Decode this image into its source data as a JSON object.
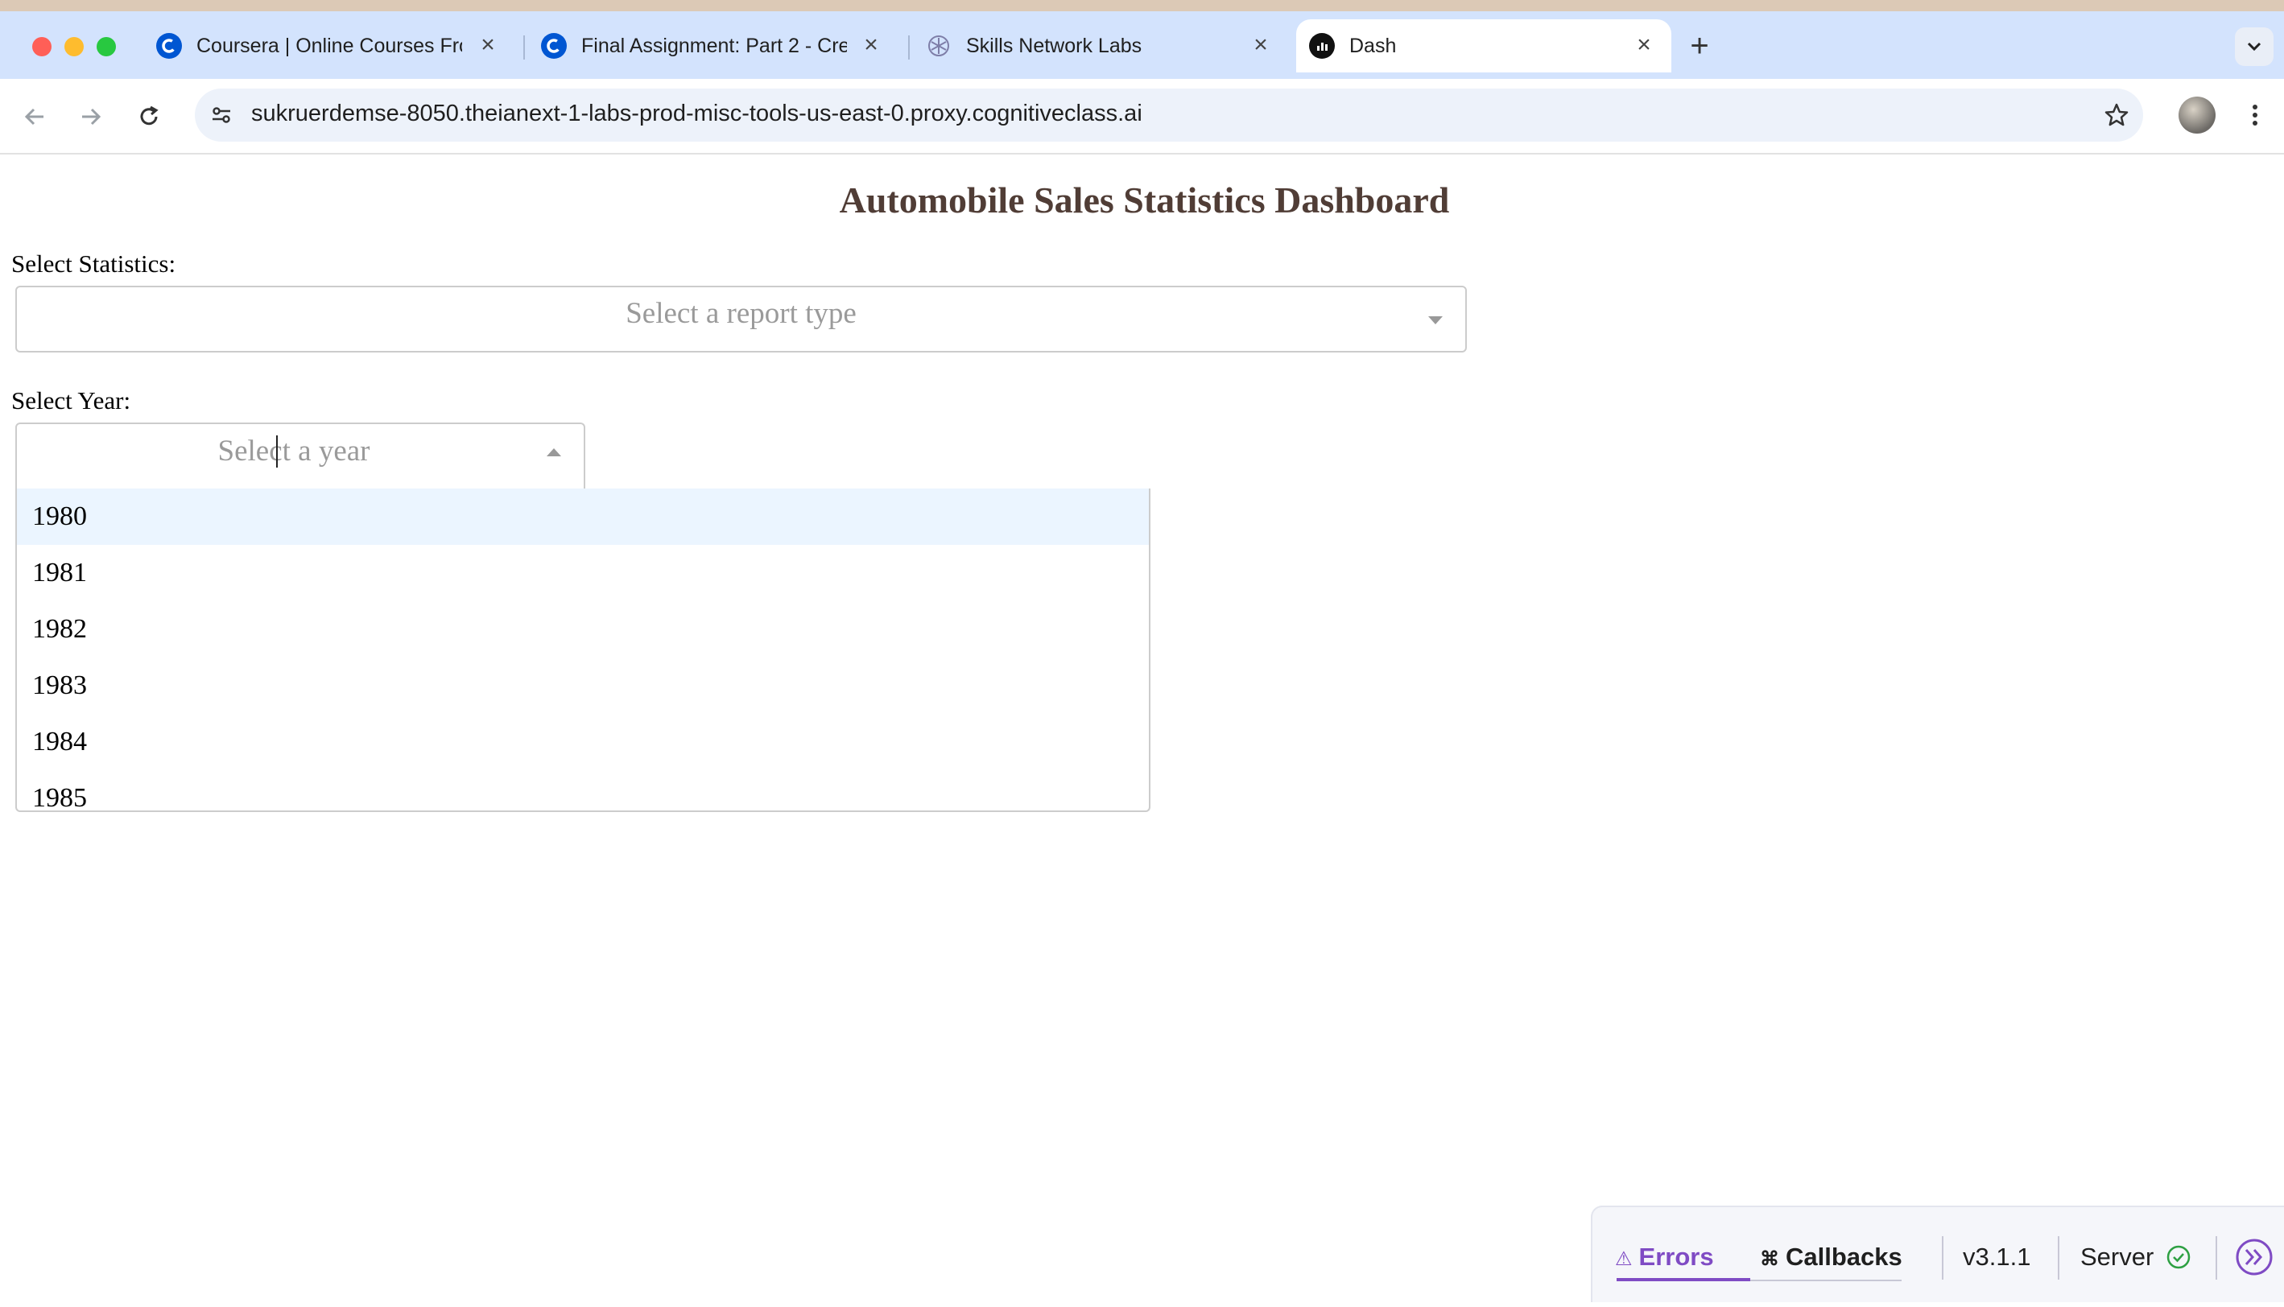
{
  "browser": {
    "tabs": [
      {
        "title": "Coursera | Online Courses Fro",
        "icon": "coursera-icon"
      },
      {
        "title": "Final Assignment: Part 2 - Cre",
        "icon": "coursera-icon"
      },
      {
        "title": "Skills Network Labs",
        "icon": "skills-network-icon"
      },
      {
        "title": "Dash",
        "icon": "dash-icon"
      }
    ],
    "url": "sukruerdemse-8050.theianext-1-labs-prod-misc-tools-us-east-0.proxy.cognitiveclass.ai"
  },
  "dashboard": {
    "title": "Automobile Sales Statistics Dashboard",
    "statistics_label": "Select Statistics:",
    "statistics_placeholder": "Select a report type",
    "year_label": "Select Year:",
    "year_placeholder": "Select a year",
    "year_options": [
      "1980",
      "1981",
      "1982",
      "1983",
      "1984",
      "1985"
    ]
  },
  "debug_bar": {
    "errors_label": "Errors",
    "callbacks_label": "Callbacks",
    "version": "v3.1.1",
    "server_label": "Server"
  },
  "colors": {
    "title": "#503d36",
    "tabbar": "#d3e3fd",
    "highlight_option": "#ebf5ff",
    "accent": "#7f4bc4"
  }
}
